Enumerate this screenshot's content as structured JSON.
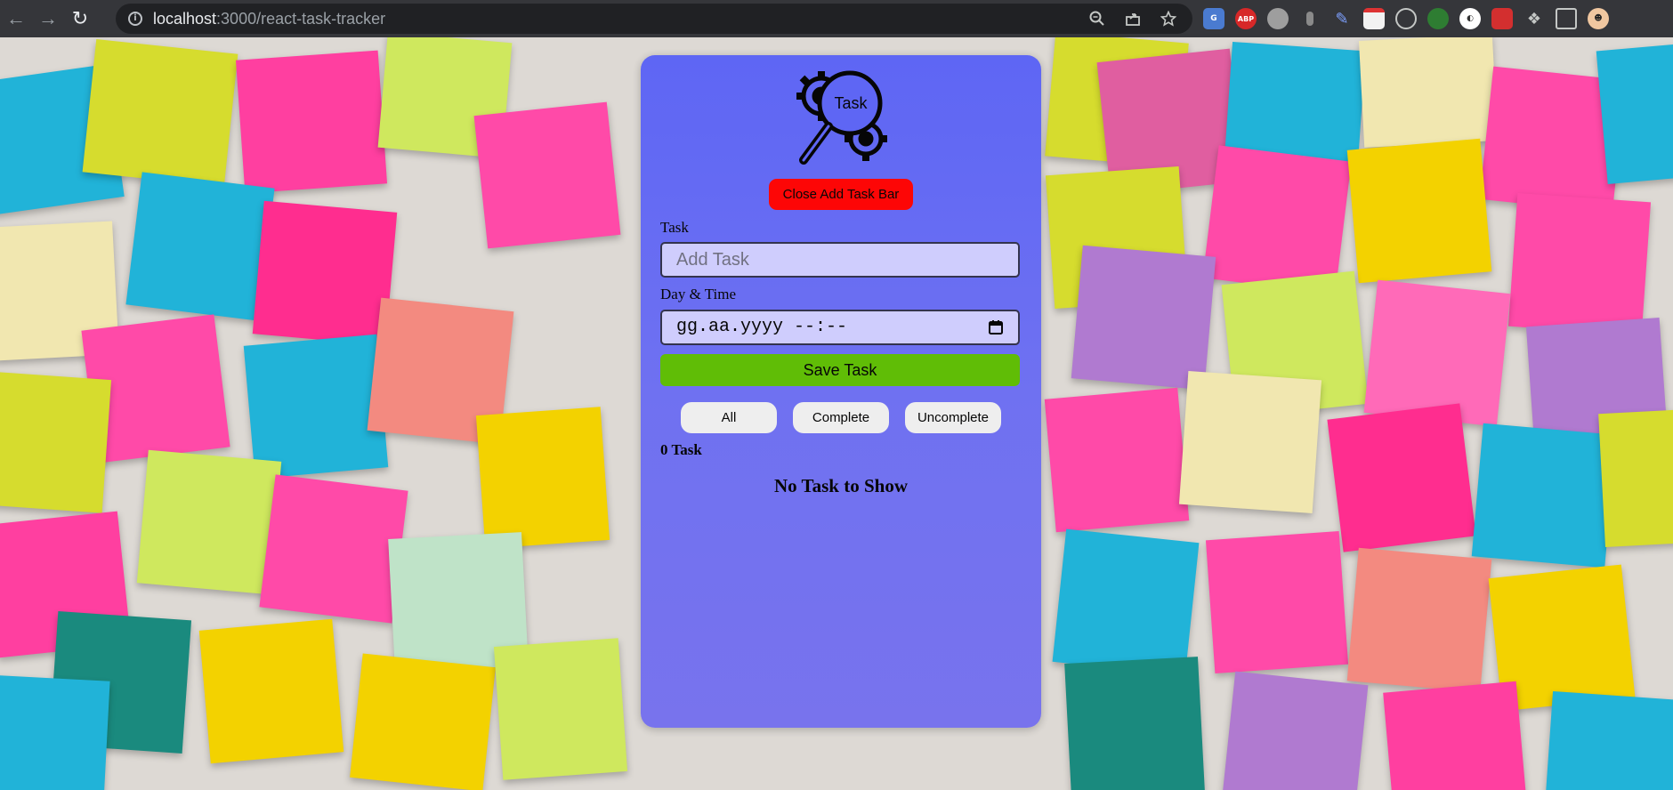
{
  "browser": {
    "url_host": "localhost",
    "url_path": ":3000/react-task-tracker",
    "extensions": [
      {
        "name": "translate-ext",
        "label": "G",
        "color": "#4a7bd0"
      },
      {
        "name": "adblock-plus-ext",
        "label": "ABP",
        "color": "#d72828"
      },
      {
        "name": "glasses-ext",
        "label": "",
        "color": "#8a8a8a"
      },
      {
        "name": "figure-ext",
        "label": "",
        "color": "#6b6b6b"
      },
      {
        "name": "pen-ext",
        "label": "",
        "color": "#3a5aa8"
      },
      {
        "name": "calendar-ext",
        "label": "",
        "color": "#e6e6e6"
      },
      {
        "name": "compass-ext",
        "label": "",
        "color": "#5f6368"
      },
      {
        "name": "tree-ext",
        "label": "",
        "color": "#2e7d32"
      },
      {
        "name": "circle-ext",
        "label": "",
        "color": "#ffffff"
      },
      {
        "name": "grid-ext",
        "label": "",
        "color": "#d32f2f"
      }
    ]
  },
  "app": {
    "logo_text": "Task",
    "close_button_label": "Close Add Task Bar",
    "task_label": "Task",
    "task_placeholder": "Add Task",
    "datetime_label": "Day & Time",
    "datetime_placeholder": "gg.aa.yyyy --:--",
    "save_button_label": "Save Task",
    "filters": [
      "All",
      "Complete",
      "Uncomplete"
    ],
    "task_count": "0 Task",
    "empty_message": "No Task to Show"
  },
  "colors": {
    "panel": "#5a63f6",
    "close_button": "#ff0000",
    "save_button": "#5cbd00",
    "input_bg": "#cfcdff"
  }
}
